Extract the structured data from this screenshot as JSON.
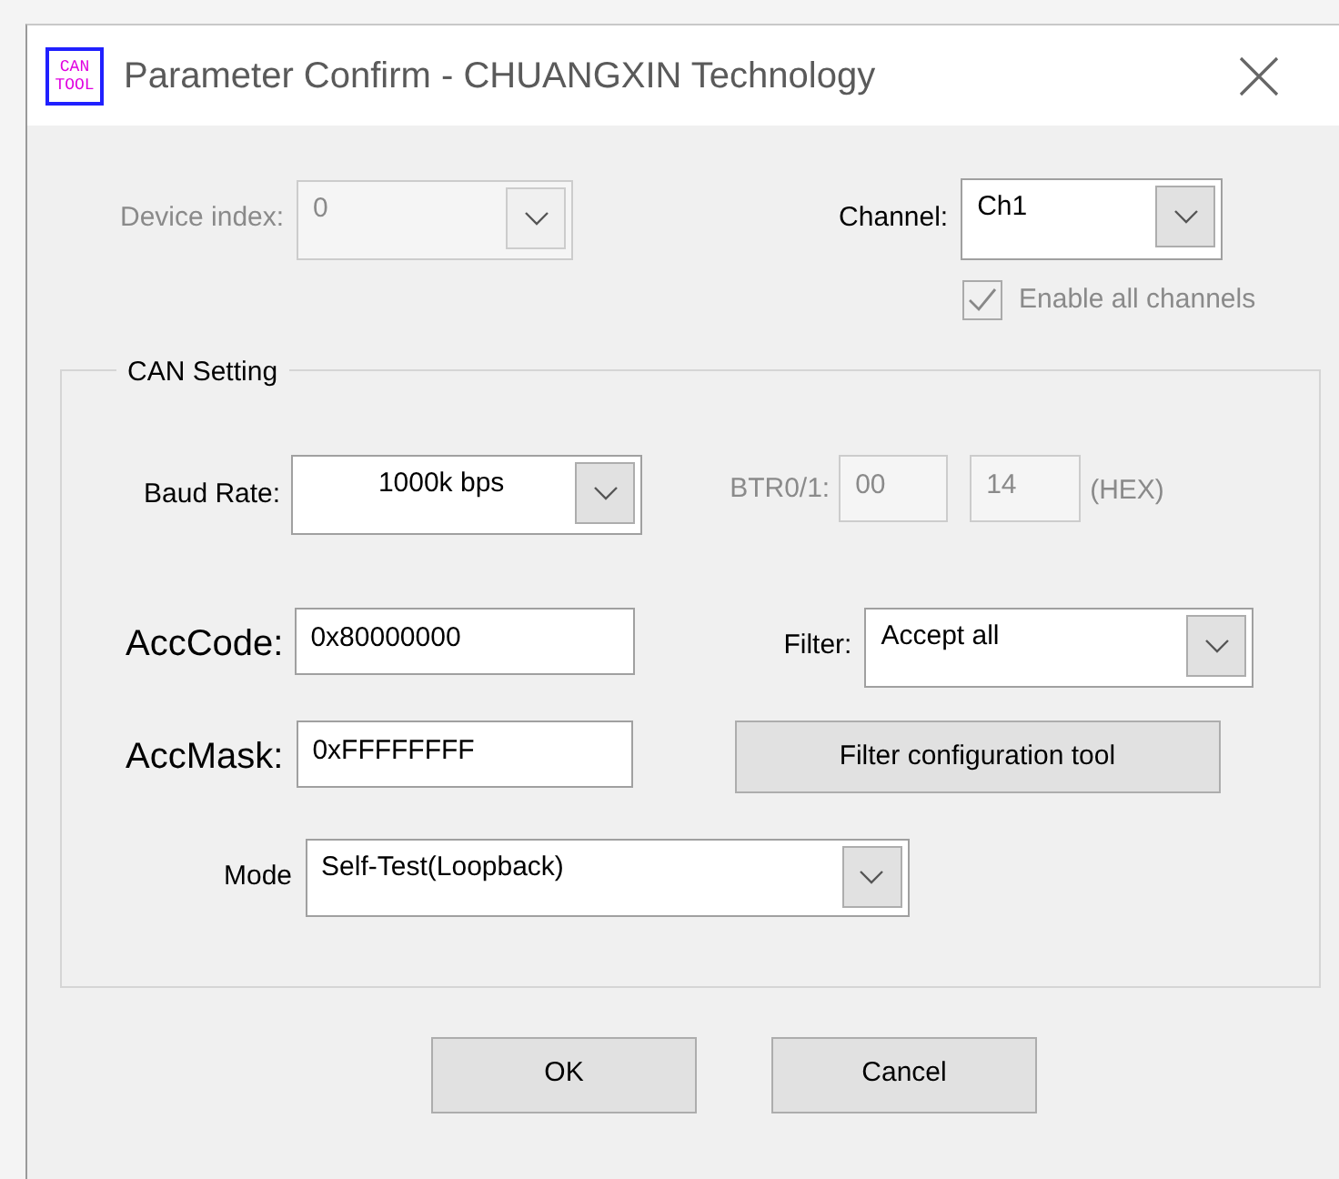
{
  "window": {
    "title": "Parameter Confirm - CHUANGXIN Technology",
    "icon_text": [
      "CAN",
      "TOOL"
    ]
  },
  "device_index": {
    "label": "Device index:",
    "value": "0",
    "disabled": true
  },
  "channel": {
    "label": "Channel:",
    "value": "Ch1",
    "disabled": false
  },
  "enable_all_channels": {
    "label": "Enable all channels",
    "checked": true,
    "disabled": true
  },
  "can_setting": {
    "title": "CAN Setting",
    "baud_rate": {
      "label": "Baud Rate:",
      "value": "1000k bps"
    },
    "btr": {
      "label": "BTR0/1:",
      "btr0": "00",
      "btr1": "14",
      "unit": "(HEX)",
      "disabled": true
    },
    "acc_code": {
      "label": "AccCode:",
      "value": "0x80000000"
    },
    "acc_mask": {
      "label": "AccMask:",
      "value": "0xFFFFFFFF"
    },
    "filter": {
      "label": "Filter:",
      "value": "Accept all"
    },
    "filter_tool_button": "Filter configuration tool",
    "mode": {
      "label": "Mode",
      "value": "Self-Test(Loopback)"
    }
  },
  "buttons": [
    "OK",
    "Cancel"
  ]
}
